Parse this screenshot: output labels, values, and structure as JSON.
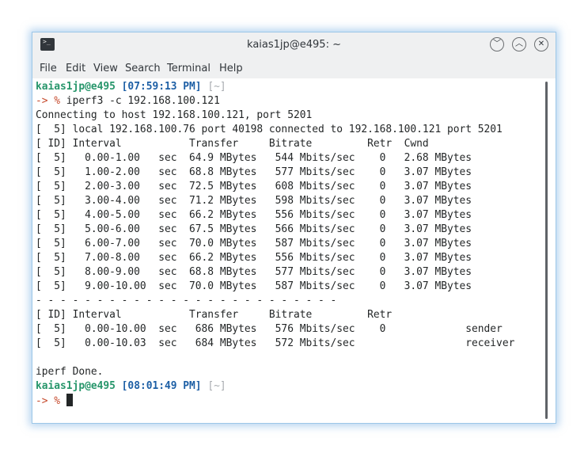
{
  "window": {
    "title": "kaias1jp@e495: ~",
    "icon_name": "terminal-icon"
  },
  "controls": {
    "minimize": "﹀",
    "maximize": "︿",
    "close": "✕"
  },
  "menu": [
    "File",
    "Edit",
    "View",
    "Search",
    "Terminal",
    "Help"
  ],
  "terminal": {
    "prompt1": {
      "user": "kaias1jp@e495",
      "time": "[07:59:13 PM]",
      "dir": "[~]",
      "arrow": "-> %",
      "command": " iperf3 -c 192.168.100.121"
    },
    "lines": [
      "Connecting to host 192.168.100.121, port 5201",
      "[  5] local 192.168.100.76 port 40198 connected to 192.168.100.121 port 5201",
      "[ ID] Interval           Transfer     Bitrate         Retr  Cwnd",
      "[  5]   0.00-1.00   sec  64.9 MBytes   544 Mbits/sec    0   2.68 MBytes",
      "[  5]   1.00-2.00   sec  68.8 MBytes   577 Mbits/sec    0   3.07 MBytes",
      "[  5]   2.00-3.00   sec  72.5 MBytes   608 Mbits/sec    0   3.07 MBytes",
      "[  5]   3.00-4.00   sec  71.2 MBytes   598 Mbits/sec    0   3.07 MBytes",
      "[  5]   4.00-5.00   sec  66.2 MBytes   556 Mbits/sec    0   3.07 MBytes",
      "[  5]   5.00-6.00   sec  67.5 MBytes   566 Mbits/sec    0   3.07 MBytes",
      "[  5]   6.00-7.00   sec  70.0 MBytes   587 Mbits/sec    0   3.07 MBytes",
      "[  5]   7.00-8.00   sec  66.2 MBytes   556 Mbits/sec    0   3.07 MBytes",
      "[  5]   8.00-9.00   sec  68.8 MBytes   577 Mbits/sec    0   3.07 MBytes",
      "[  5]   9.00-10.00  sec  70.0 MBytes   587 Mbits/sec    0   3.07 MBytes",
      "- - - - - - - - - - - - - - - - - - - - - - - - -",
      "[ ID] Interval           Transfer     Bitrate         Retr",
      "[  5]   0.00-10.00  sec   686 MBytes   576 Mbits/sec    0             sender",
      "[  5]   0.00-10.03  sec   684 MBytes   572 Mbits/sec                  receiver",
      "",
      "iperf Done."
    ],
    "prompt2": {
      "user": "kaias1jp@e495",
      "time": "[08:01:49 PM]",
      "dir": "[~]",
      "arrow": "-> %"
    }
  }
}
